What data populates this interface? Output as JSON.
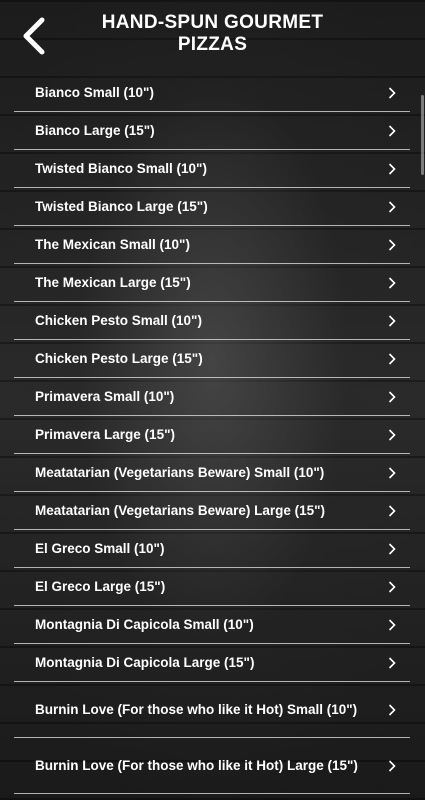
{
  "header": {
    "title_line1": "HAND-SPUN GOURMET",
    "title_line2": "PIZZAS",
    "back_icon": "chevron-left-icon"
  },
  "menu": {
    "items": [
      {
        "label": "Bianco Small (10\")"
      },
      {
        "label": "Bianco Large (15\")"
      },
      {
        "label": "Twisted Bianco Small (10\")"
      },
      {
        "label": "Twisted Bianco Large (15\")"
      },
      {
        "label": "The Mexican Small (10\")"
      },
      {
        "label": "The Mexican Large (15\")"
      },
      {
        "label": "Chicken Pesto Small (10\")"
      },
      {
        "label": "Chicken Pesto Large (15\")"
      },
      {
        "label": "Primavera Small (10\")"
      },
      {
        "label": "Primavera Large (15\")"
      },
      {
        "label": "Meatatarian (Vegetarians Beware) Small (10\")"
      },
      {
        "label": "Meatatarian (Vegetarians Beware) Large (15\")"
      },
      {
        "label": "El Greco Small (10\")"
      },
      {
        "label": "El Greco Large (15\")"
      },
      {
        "label": "Montagnia Di Capicola Small (10\")"
      },
      {
        "label": "Montagnia Di Capicola Large (15\")"
      },
      {
        "label": "Burnin Love (For those who like it Hot) Small (10\")"
      },
      {
        "label": "Burnin Love (For those who like it Hot) Large (15\")"
      }
    ],
    "row_icon": "chevron-right-icon"
  }
}
